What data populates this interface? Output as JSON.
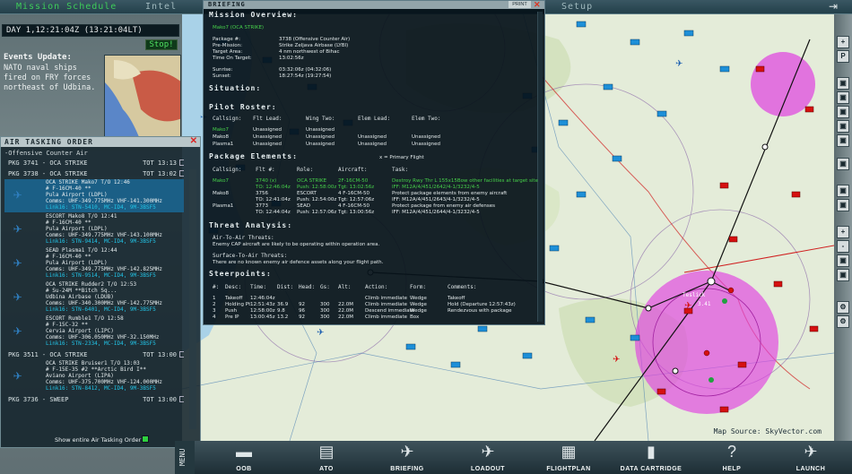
{
  "topbar": {
    "mission_schedule": "Mission Schedule",
    "intel": "Intel",
    "setup": "Setup"
  },
  "clock": {
    "day_text": "DAY 1,12:21:04Z (13:21:04LT)"
  },
  "stop_label": "Stop!",
  "events": {
    "title": "Events Update:",
    "text": "NATO naval ships fired on FRY forces northeast of Udbina."
  },
  "ato": {
    "title": "AIR TASKING ORDER",
    "group": "-Offensive Counter Air",
    "packages": [
      {
        "pkg": "PKG 3741",
        "type": "OCA STRIKE",
        "tot": "TOT 13:13"
      },
      {
        "pkg": "PKG 3738",
        "type": "OCA STRIKE",
        "tot": "TOT 13:02"
      }
    ],
    "flights": [
      {
        "l1": "OCA STRIKE            Mako7  T/O 12:46",
        "l2": "# F-16CM-40  **",
        "l3": "Pula Airport (LDPL)",
        "l4": "Comms: UHF-349.775MHz VHF-141.300MHz",
        "l5": "Link16: STN-5410, MC-ID4, 9M-3BSF5",
        "sel": true
      },
      {
        "l1": "ESCORT               Mako8  T/O 12:41",
        "l2": "# F-16CM-40  **",
        "l3": "Pula Airport (LDPL)",
        "l4": "Comms: UHF-349.775MHz VHF-143.100MHz",
        "l5": "Link16: STN-9414, MC-ID4, 9M-3BSF5",
        "sel": false
      },
      {
        "l1": "SEAD                Plasma1  T/O 12:44",
        "l2": "# F-16CM-40  **",
        "l3": "Pula Airport (LDPL)",
        "l4": "Comms: UHF-349.775MHz VHF-142.825MHz",
        "l5": "Link16: STN-9514, MC-ID4, 9M-3BSF5",
        "sel": false
      },
      {
        "l1": "OCA STRIKE          Rudder2  T/O 12:53",
        "l2": "# Su-24M  **Bitch Sq...",
        "l3": "Udbina Airbase (LDUB)",
        "l4": "Comms: UHF-340.300MHz VHF-142.775MHz",
        "l5": "Link16: STN-6401, MC-ID4, 9M-3BSF5",
        "sel": false
      },
      {
        "l1": "ESCORT               Rumble1  T/O 12:58",
        "l2": "# F-15C-32  **",
        "l3": "Cervia Airport (LIPC)",
        "l4": "Comms: UHF-306.050MHz VHF-32.150MHz",
        "l5": "Link16: STN-2334, MC-ID4, 9M-3BSF5",
        "sel": false
      },
      {
        "l1": "OCA STRIKE       Bruiser1  T/O 13:03",
        "l2": "# F-15E-35 #2  **Arctic Bird I**",
        "l3": "Aviano Airport (LIPA)",
        "l4": "Comms: UHF-375.700MHz VHF-124.000MHz",
        "l5": "Link16: STN-8412, MC-ID4, 9M-3BSF5",
        "sel": false
      }
    ],
    "pkg_mid": {
      "pkg": "PKG 3511",
      "type": "OCA STRIKE",
      "tot": "TOT 13:00"
    },
    "pkg_last": {
      "pkg": "PKG 3736",
      "type": "SWEEP",
      "tot": "TOT 13:00"
    },
    "show_entire": "Show entire Air Tasking Order"
  },
  "briefing": {
    "title": "BRIEFING",
    "print": "PRINT",
    "h_overview": "Mission Overview:",
    "flight_name": "Mako7 (OCA STRIKE)",
    "ov_labels": [
      "Package #:",
      "Pre-Mission:",
      "Target Area:",
      "Time On Target:",
      "Sunrise:",
      "Sunset:"
    ],
    "ov_values": [
      "3738 (Offensive Counter Air)",
      "Strike Zeljava Airbase (LYBI)",
      "4 nm northwest of Bihac",
      "13:02:56z",
      "03:32:06z (04:32:06)",
      "18:27:54z (19:27:54)"
    ],
    "h_situation": "Situation:",
    "h_roster": "Pilot Roster:",
    "roster_headers": [
      "Callsign:",
      "Flt Lead:",
      "Wing Two:",
      "Elem Lead:",
      "Elem Two:"
    ],
    "roster_rows": [
      [
        "Mako7",
        "Unassigned",
        "Unassigned",
        "",
        ""
      ],
      [
        "Mako8",
        "Unassigned",
        "Unassigned",
        "Unassigned",
        "Unassigned"
      ],
      [
        "Plasma1",
        "Unassigned",
        "Unassigned",
        "Unassigned",
        "Unassigned"
      ]
    ],
    "h_elements": "Package Elements:",
    "primary_note": "x = Primary Flight",
    "elem_headers": [
      "Callsign:",
      "Flt #:",
      "Role:",
      "Aircraft:",
      "Task:"
    ],
    "elem_rows": [
      [
        "Mako7",
        "3740 (x)",
        "OCA STRIKE",
        "2F-16CM-50",
        "Destroy Rwy Thr L 155x15Bow other facilities at target site"
      ],
      [
        "",
        "TO: 12:46:04z",
        "Push: 12:58:00z",
        "Tgt: 13:02:56z",
        "IFF: M12A/4/451/2642/4-1/3232/4-5"
      ],
      [
        "Mako8",
        "3756",
        "ESCORT",
        "4 F-16CM-50",
        "Protect package elements from enemy aircraft"
      ],
      [
        "",
        "TO: 12:41:04z",
        "Push: 12:54:00z",
        "Tgt: 12:57:06z",
        "IFF: M12A/4/451/2643/4-1/3232/4-5"
      ],
      [
        "Plasma1",
        "3773",
        "SEAD",
        "4 F-16CM-50",
        "Protect package from enemy air defenses"
      ],
      [
        "",
        "TO: 12:44:04z",
        "Push: 12:57:06z",
        "Tgt: 13:00:56z",
        "IFF: M12A/4/451/2644/4-1/3232/4-5"
      ]
    ],
    "h_threat": "Threat Analysis:",
    "aa_title": "Air-To-Air Threats:",
    "aa_text": "Enemy CAP aircraft are likely to be operating within operation area.",
    "sa_title": "Surface-To-Air Threats:",
    "sa_text": "There are no known enemy air defence assets along your flight path.",
    "h_steer": "Steerpoints:",
    "steer_headers": [
      "#:",
      "Desc:",
      "Time:",
      "Dist:",
      "Head:",
      "Gs:",
      "Alt:",
      "Action:",
      "Form:",
      "Comments:"
    ],
    "steer_rows": [
      [
        "1",
        "Takeoff",
        "12:46:04z",
        "",
        "",
        "",
        "",
        "Climb immediate",
        "Wedge",
        "Takeoff"
      ],
      [
        "2",
        "Holding Pt",
        "12:51:43z",
        "36.9",
        "92",
        "300",
        "22.0M",
        "Climb immediate",
        "Wedge",
        "Hold (Departure 12:57:43z)"
      ],
      [
        "3",
        "Push",
        "12:58:00z",
        "9.8",
        "96",
        "300",
        "22.0M",
        "Descend immediate",
        "Wedge",
        "Rendezvous with package"
      ],
      [
        "4",
        "Pre IP",
        "13:00:45z",
        "13.2",
        "92",
        "300",
        "22.0M",
        "Climb immediate",
        "Box",
        ""
      ]
    ]
  },
  "map_source": "Map Source: SkyVector.com",
  "map_labels": [
    "Teslick",
    "3.41",
    "P0",
    "P0"
  ],
  "bottom": {
    "menu": "MENU",
    "buttons": [
      "OOB",
      "ATO",
      "BRIEFING",
      "LOADOUT",
      "FLIGHTPLAN",
      "DATA CARTRIDGE",
      "HELP",
      "LAUNCH"
    ]
  },
  "right_toolbar": [
    "P",
    "+",
    "-"
  ],
  "colors": {
    "accent_green": "#3ecc5a",
    "threat_magenta": "#e040e0",
    "selected_blue": "#1b5f86"
  }
}
